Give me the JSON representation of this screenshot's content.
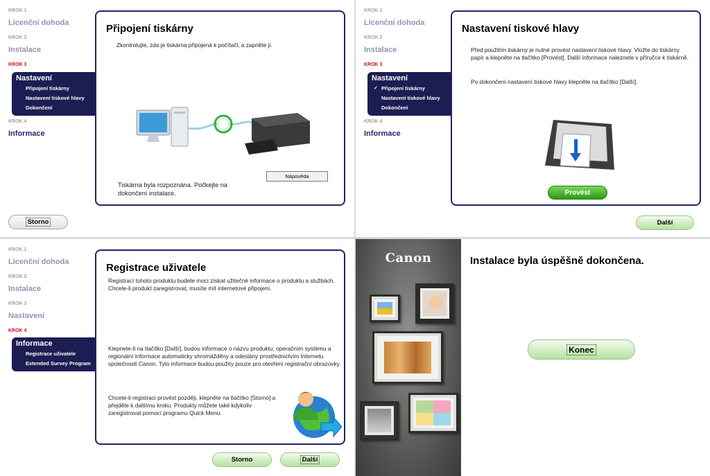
{
  "steps": [
    {
      "label": "KROK 1",
      "name": "Licenční dohoda"
    },
    {
      "label": "KROK 2",
      "name": "Instalace"
    },
    {
      "label": "KROK 3",
      "name": "Nastavení"
    },
    {
      "label": "KROK 4",
      "name": "Informace"
    }
  ],
  "panel1": {
    "title": "Připojení tiskárny",
    "instruction": "Zkontrolujte, zda je tiskárna připojená k počítači, a zapněte ji.",
    "active_step": "Nastavení",
    "substeps": [
      "Připojení tiskárny",
      "Nastavení tiskové hlavy",
      "Dokončení"
    ],
    "help_button": "Nápověda",
    "status": "Tiskárna byla rozpoznána. Počkejte na dokončení instalace.",
    "cancel_button": "Storno"
  },
  "panel2": {
    "title": "Nastavení tiskové hlavy",
    "active_step": "Nastavení",
    "substeps": [
      "Připojení tiskárny",
      "Nastavení tiskové hlavy",
      "Dokončení"
    ],
    "check_mark": "✓",
    "para1": "Před použitím tiskárny je nutné provést nastavení tiskové hlavy. Vložte do tiskárny papír a klepněte na tlačítko [Provést]. Další informace naleznete v příručce k tiskárně.",
    "para2": "Po dokončení nastavení tiskové hlavy klepněte na tlačítko [Další].",
    "execute_button": "Provést",
    "next_button": "Další"
  },
  "panel3": {
    "title": "Registrace uživatele",
    "active_step": "Informace",
    "substeps": [
      "Registrace uživatele",
      "Extended Survey Program"
    ],
    "para1": "Registrací tohoto produktu budete moci získat užitečné informace o produktu a službách. Chcete-li produkt zaregistrovat, musíte mít internetové připojení.",
    "para2": "Klepnete-li na tlačítko [Další], budou informace o názvu produktu, operačním systému a regionální informace automaticky shromážděny a odeslány prostřednictvím Internetu společnosti Canon. Tyto informace budou použity pouze pro otevření registrační obrazovky.",
    "para3": "Chcete-li registraci provést později, klepněte na tlačítko [Storno] a přejděte k dalšímu kroku. Produkty můžete také kdykoliv zaregistrovat pomocí programu Quick Menu.",
    "cancel_button": "Storno",
    "next_button": "Další"
  },
  "panel4": {
    "brand": "Canon",
    "title": "Instalace byla úspěšně dokončena.",
    "finish_button": "Konec"
  },
  "colors": {
    "accent_navy": "#1c1d52",
    "current_step_red": "#cc1010",
    "button_green": "#cfeec2",
    "execute_green": "#2d9a16"
  }
}
